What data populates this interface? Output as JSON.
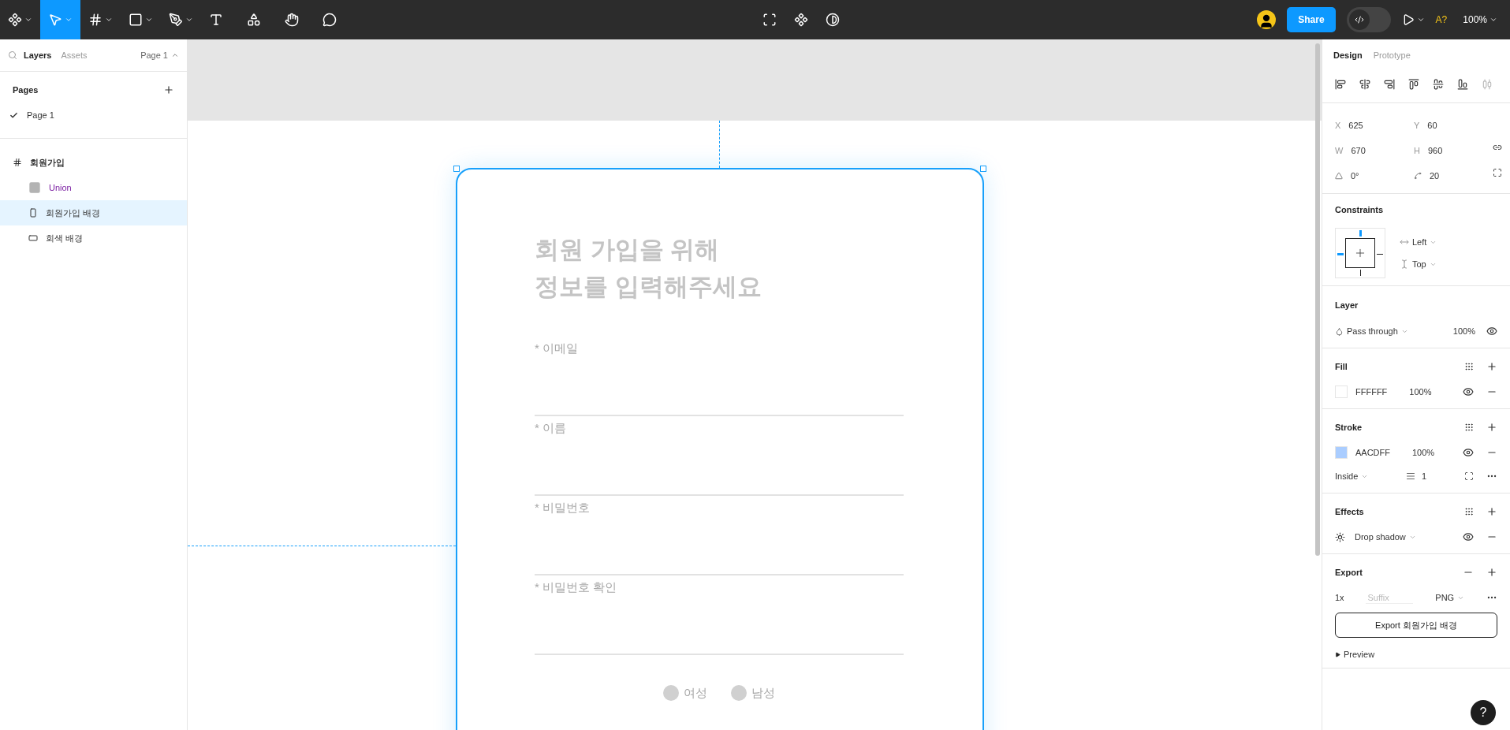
{
  "toolbar": {
    "tools": [
      {
        "kind": "main-menu",
        "selected": false
      },
      {
        "kind": "move",
        "selected": true
      },
      {
        "kind": "frame",
        "selected": false
      },
      {
        "kind": "shape",
        "selected": false
      },
      {
        "kind": "pen",
        "selected": false
      },
      {
        "kind": "text",
        "selected": false
      },
      {
        "kind": "resources",
        "selected": false
      },
      {
        "kind": "hand",
        "selected": false
      },
      {
        "kind": "comment",
        "selected": false
      }
    ],
    "share": "Share",
    "dev_mode": false,
    "font_warning": "A?",
    "zoom": "100%"
  },
  "left_panel": {
    "tabs": [
      {
        "label": "Layers",
        "selected": true
      },
      {
        "label": "Assets",
        "selected": false
      }
    ],
    "page_switcher": "Page 1",
    "pages_heading": "Pages",
    "pages": [
      {
        "label": "Page 1",
        "selected": true
      }
    ],
    "layers": [
      {
        "label": "회원가입",
        "kind": "frame",
        "selected": false,
        "children": [
          {
            "label": "Union",
            "kind": "union",
            "selected": false
          },
          {
            "label": "회원가입 배경",
            "kind": "rect-tall",
            "selected": true
          },
          {
            "label": "회색 배경",
            "kind": "rect-wide",
            "selected": false
          }
        ]
      }
    ]
  },
  "canvas": {
    "frame": {
      "title_lines": [
        "회원 가입을 위해",
        "정보를 입력해주세요"
      ],
      "fields": [
        {
          "label": "* 이메일"
        },
        {
          "label": "* 이름"
        },
        {
          "label": "* 비밀번호"
        },
        {
          "label": "* 비밀번호 확인"
        }
      ],
      "genders": [
        {
          "label": "여성",
          "selected": false
        },
        {
          "label": "남성",
          "selected": false
        }
      ]
    }
  },
  "right_panel": {
    "tabs": [
      {
        "label": "Design",
        "selected": true
      },
      {
        "label": "Prototype",
        "selected": false
      }
    ],
    "geometry": [
      {
        "kind": "label",
        "label": "X",
        "value": "625"
      },
      {
        "kind": "label",
        "label": "Y",
        "value": "60"
      },
      {
        "kind": "label",
        "label": "W",
        "value": "670"
      },
      {
        "kind": "label",
        "label": "H",
        "value": "960"
      },
      {
        "kind": "rotation",
        "value": "0°"
      },
      {
        "kind": "radius",
        "value": "20"
      }
    ],
    "constraints": {
      "heading": "Constraints",
      "horizontal": "Left",
      "vertical": "Top"
    },
    "layer": {
      "heading": "Layer",
      "blend": "Pass through",
      "opacity": "100%"
    },
    "fill": {
      "heading": "Fill",
      "color": "#ffffff",
      "hex": "FFFFFF",
      "opacity": "100%"
    },
    "stroke": {
      "heading": "Stroke",
      "color": "#aacdff",
      "hex": "AACDFF",
      "opacity": "100%",
      "position": "Inside",
      "weight": "1"
    },
    "effects": {
      "heading": "Effects",
      "effect": "Drop shadow"
    },
    "export": {
      "heading": "Export",
      "scale": "1x",
      "suffix_placeholder": "Suffix",
      "format": "PNG",
      "button": "Export 회원가입 배경",
      "preview": "Preview"
    },
    "help": "?"
  }
}
